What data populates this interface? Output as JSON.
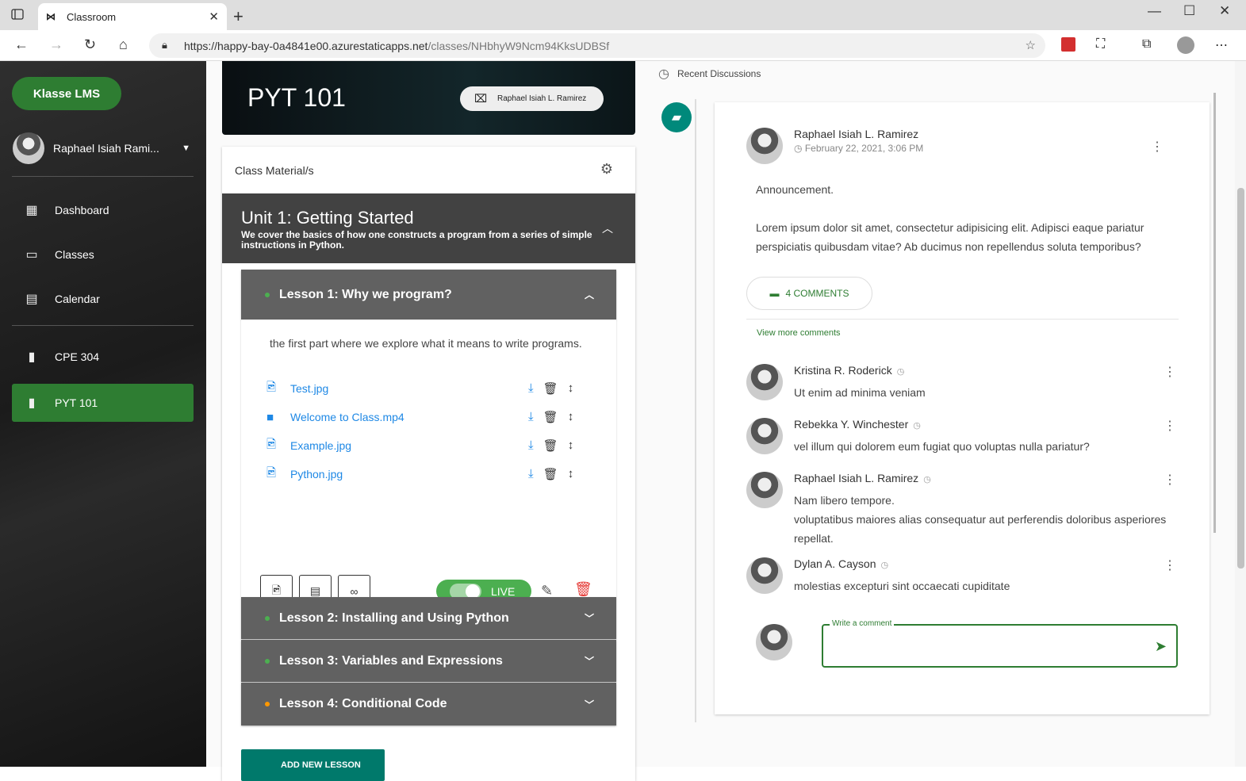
{
  "browser": {
    "tab_title": "Classroom",
    "url_domain": "https://happy-bay-0a4841e00.azurestaticapps.net",
    "url_path": "/classes/NHbhyW9Ncm94KksUDBSf"
  },
  "sidebar": {
    "brand": "Klasse LMS",
    "user_name": "Raphael Isiah Rami...",
    "nav": [
      {
        "label": "Dashboard",
        "icon": "dashboard-icon"
      },
      {
        "label": "Classes",
        "icon": "classes-icon"
      },
      {
        "label": "Calendar",
        "icon": "calendar-icon"
      }
    ],
    "classes": [
      {
        "label": "CPE 304",
        "icon": "class-book-icon"
      },
      {
        "label": "PYT 101",
        "icon": "class-book-icon",
        "active": true
      }
    ],
    "active_color": "#2e7d32"
  },
  "banner": {
    "title": "PYT 101",
    "teacher": "Raphael Isiah L. Ramirez"
  },
  "materials": {
    "title": "Class Material/s",
    "unit": {
      "title": "Unit 1: Getting Started",
      "description": "We cover the basics of how one constructs a program from a series of simple instructions in Python."
    },
    "lessons": [
      {
        "title": "Lesson 1: Why we program?",
        "status": "green",
        "expanded": true
      },
      {
        "title": "Lesson 2: Installing and Using Python",
        "status": "green"
      },
      {
        "title": "Lesson 3: Variables and Expressions",
        "status": "green"
      },
      {
        "title": "Lesson 4: Conditional Code",
        "status": "orange"
      }
    ],
    "lesson1_description": "the first part where we explore what it means to write programs.",
    "files": [
      {
        "name": "Test.jpg",
        "icon": "image-file-icon"
      },
      {
        "name": "Welcome to Class.mp4",
        "icon": "video-file-icon"
      },
      {
        "name": "Example.jpg",
        "icon": "image-file-icon"
      },
      {
        "name": "Python.jpg",
        "icon": "image-file-icon"
      }
    ],
    "live_label": "LIVE",
    "add_lesson": "ADD NEW LESSON"
  },
  "discussions": {
    "header": "Recent Discussions",
    "post": {
      "author": "Raphael Isiah L. Ramirez",
      "date": "February 22, 2021, 3:06 PM",
      "announcement": "Announcement.",
      "body": "Lorem ipsum dolor sit amet, consectetur adipisicing elit. Adipisci eaque pariatur perspiciatis quibusdam vitae? Ab ducimus non repellendus soluta temporibus?",
      "comments_button": "4 COMMENTS",
      "view_more": "View more comments"
    },
    "comments": [
      {
        "author": "Kristina R. Roderick",
        "text": "Ut enim ad minima veniam"
      },
      {
        "author": "Rebekka Y. Winchester",
        "text": "vel illum qui dolorem eum fugiat quo voluptas nulla pariatur?"
      },
      {
        "author": "Raphael Isiah L. Ramirez",
        "text": "Nam libero tempore.\nvoluptatibus maiores alias consequatur aut perferendis doloribus asperiores repellat."
      },
      {
        "author": "Dylan A. Cayson",
        "text": "molestias excepturi sint occaecati cupiditate"
      }
    ],
    "comment_placeholder": "Write a comment"
  }
}
